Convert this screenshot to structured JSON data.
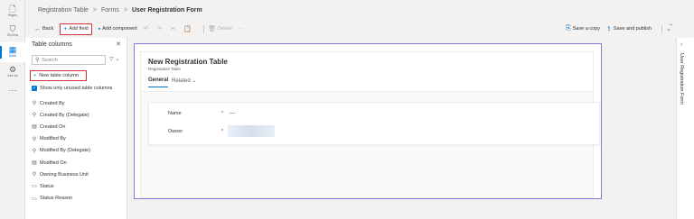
{
  "nav": {
    "items": [
      {
        "label": "Pages",
        "icon": "page-icon"
      },
      {
        "label": "Styling",
        "icon": "styling-icon"
      },
      {
        "label": "Data",
        "icon": "data-icon"
      },
      {
        "label": "Set up",
        "icon": "setup-icon"
      },
      {
        "label": "···",
        "icon": "more-icon"
      }
    ]
  },
  "breadcrumb": {
    "items": [
      "Registration Table",
      "Forms"
    ],
    "current": "User Registration Form",
    "separator": ">"
  },
  "toolbar": {
    "back": "Back",
    "add_field": "Add field",
    "add_component": "Add component",
    "delete": "Delete",
    "more": "···",
    "save_copy": "Save a copy",
    "save_publish": "Save and publish"
  },
  "panel": {
    "title": "Table columns",
    "search_placeholder": "Search",
    "new_column": "New table column",
    "show_unused": "Show only unused table columns",
    "columns": [
      {
        "label": "Created By",
        "icon": "lookup-icon"
      },
      {
        "label": "Created By (Delegate)",
        "icon": "lookup-icon"
      },
      {
        "label": "Created On",
        "icon": "calendar-icon"
      },
      {
        "label": "Modified By",
        "icon": "lookup-icon"
      },
      {
        "label": "Modified By (Delegate)",
        "icon": "lookup-icon"
      },
      {
        "label": "Modified On",
        "icon": "calendar-icon"
      },
      {
        "label": "Owning Business Unit",
        "icon": "lookup-icon"
      },
      {
        "label": "Status",
        "icon": "optionset-icon"
      },
      {
        "label": "Status Reason",
        "icon": "optionset-icon"
      }
    ]
  },
  "form": {
    "title": "New Registration Table",
    "subtitle": "Registration Table",
    "tabs": [
      "General",
      "Related"
    ],
    "fields": [
      {
        "label": "Name",
        "required": "*",
        "value": "---"
      },
      {
        "label": "Owner",
        "required": "*",
        "value": ""
      }
    ]
  },
  "right_panel": {
    "label": "User Registration Form"
  },
  "colors": {
    "accent": "#0078d4",
    "highlight_border": "#d13438",
    "form_frame": "#8378de"
  }
}
